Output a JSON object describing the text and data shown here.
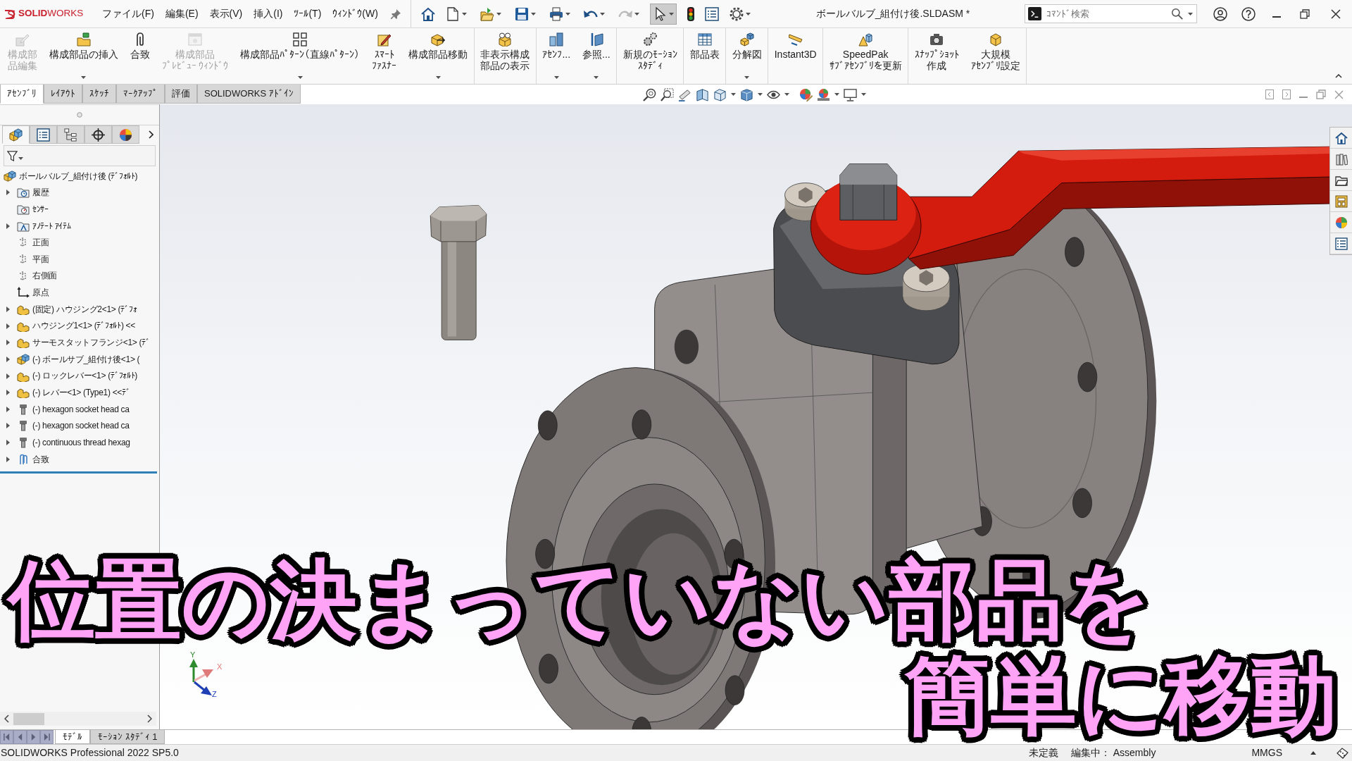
{
  "title_bar": {
    "logo": "**SOLID**WORKS",
    "menus": [
      "ファイル(F)",
      "編集(E)",
      "表示(V)",
      "挿入(I)",
      "ﾂｰﾙ(T)",
      "ｳｨﾝﾄﾞｳ(W)"
    ],
    "quick_access": [
      {
        "kind": "home",
        "dropdown": false,
        "disabled": false,
        "pressed": false
      },
      {
        "kind": "new",
        "dropdown": true,
        "disabled": false,
        "pressed": false
      },
      {
        "kind": "open",
        "dropdown": true,
        "disabled": false,
        "pressed": false
      },
      {
        "kind": "save",
        "dropdown": true,
        "disabled": false,
        "pressed": false
      },
      {
        "kind": "print",
        "dropdown": true,
        "disabled": false,
        "pressed": false
      },
      {
        "kind": "undo",
        "dropdown": true,
        "disabled": false,
        "pressed": false
      },
      {
        "kind": "redo",
        "dropdown": true,
        "disabled": true,
        "pressed": false
      },
      {
        "kind": "select",
        "dropdown": true,
        "disabled": false,
        "pressed": true
      },
      {
        "kind": "rebuild",
        "dropdown": false,
        "disabled": false,
        "pressed": false
      },
      {
        "kind": "properties",
        "dropdown": false,
        "disabled": false,
        "pressed": false
      },
      {
        "kind": "options",
        "dropdown": true,
        "disabled": false,
        "pressed": false
      }
    ],
    "document_title": "ボールバルブ_組付け後.SLDASM *",
    "search": {
      "placeholder": "ｺﾏﾝﾄﾞ検索"
    }
  },
  "command_manager": {
    "groups": [
      [
        {
          "kind": "edit",
          "lines": [
            "構成部",
            "品編集"
          ],
          "disabled": true,
          "dropdown": false
        },
        {
          "kind": "insert",
          "lines": [
            "構成部品の挿入"
          ],
          "disabled": false,
          "dropdown": true
        },
        {
          "kind": "mate",
          "lines": [
            "合致"
          ],
          "disabled": false,
          "dropdown": false
        },
        {
          "kind": "preview",
          "lines": [
            "構成部品",
            "ﾌﾟﾚﾋﾞｭｰ ｳｨﾝﾄﾞｳ"
          ],
          "disabled": true,
          "dropdown": false
        },
        {
          "kind": "pattern",
          "lines": [
            "構成部品ﾊﾟﾀｰﾝ（直線ﾊﾟﾀｰﾝ）"
          ],
          "disabled": false,
          "dropdown": true
        },
        {
          "kind": "fastener",
          "lines": [
            "ｽﾏｰﾄ",
            "ﾌｧｽﾅｰ"
          ],
          "disabled": false,
          "dropdown": false
        },
        {
          "kind": "move",
          "lines": [
            "構成部品移動"
          ],
          "disabled": false,
          "dropdown": true
        }
      ],
      [
        {
          "kind": "show",
          "lines": [
            "非表示構成",
            "部品の表示"
          ],
          "disabled": false,
          "dropdown": false
        }
      ],
      [
        {
          "kind": "assembly",
          "lines": [
            "ｱｾﾝﾌ..."
          ],
          "disabled": false,
          "dropdown": true
        },
        {
          "kind": "reference",
          "lines": [
            "参照..."
          ],
          "disabled": false,
          "dropdown": true
        }
      ],
      [
        {
          "kind": "motion",
          "lines": [
            "新規のﾓｰｼｮﾝ",
            "ｽﾀﾃﾞｨ"
          ],
          "disabled": false,
          "dropdown": false
        }
      ],
      [
        {
          "kind": "bom",
          "lines": [
            "部品表"
          ],
          "disabled": false,
          "dropdown": false
        }
      ],
      [
        {
          "kind": "explode",
          "lines": [
            "分解図"
          ],
          "disabled": false,
          "dropdown": true
        }
      ],
      [
        {
          "kind": "instant3d",
          "lines": [
            "Instant3D"
          ],
          "disabled": false,
          "dropdown": false
        }
      ],
      [
        {
          "kind": "speedpak",
          "lines": [
            "SpeedPak",
            "ｻﾌﾞｱｾﾝﾌﾞﾘを更新"
          ],
          "disabled": false,
          "dropdown": false
        }
      ],
      [
        {
          "kind": "snapshot",
          "lines": [
            "ｽﾅｯﾌﾟｼｮｯﾄ",
            "作成"
          ],
          "disabled": false,
          "dropdown": false
        },
        {
          "kind": "large",
          "lines": [
            "大規模",
            "ｱｾﾝﾌﾞﾘ設定"
          ],
          "disabled": false,
          "dropdown": false
        }
      ]
    ]
  },
  "command_tabs": [
    {
      "label": "ｱｾﾝﾌﾞﾘ",
      "selected": true
    },
    {
      "label": "ﾚｲｱｳﾄ",
      "selected": false
    },
    {
      "label": "ｽｹｯﾁ",
      "selected": false
    },
    {
      "label": "ﾏｰｸｱｯﾌﾟ",
      "selected": false
    },
    {
      "label": "評価",
      "selected": false
    },
    {
      "label": "SOLIDWORKS ｱﾄﾞｲﾝ",
      "selected": false
    }
  ],
  "feature_manager": {
    "tabs": [
      {
        "kind": "features",
        "selected": true
      },
      {
        "kind": "properties",
        "selected": false
      },
      {
        "kind": "configurations",
        "selected": false
      },
      {
        "kind": "dimxpert",
        "selected": false
      },
      {
        "kind": "display",
        "selected": false
      }
    ],
    "tree": {
      "label": "ボールバルブ_組付け後 (ﾃﾞﾌｫﾙﾄ)",
      "kind": "assembly",
      "children": [
        {
          "label": "履歴",
          "kind": "history",
          "expandable": true
        },
        {
          "label": "ｾﾝｻｰ",
          "kind": "sensor",
          "expandable": false
        },
        {
          "label": "ｱﾉﾃｰﾄ ｱｲﾃﾑ",
          "kind": "annotation",
          "expandable": true
        },
        {
          "label": "正面",
          "kind": "plane",
          "expandable": false
        },
        {
          "label": "平面",
          "kind": "plane",
          "expandable": false
        },
        {
          "label": "右側面",
          "kind": "plane",
          "expandable": false
        },
        {
          "label": "原点",
          "kind": "origin",
          "expandable": false
        },
        {
          "label": "(固定) ハウジング2<1> (ﾃﾞﾌｫ",
          "kind": "part",
          "expandable": true
        },
        {
          "label": "ハウジング1<1> (ﾃﾞﾌｫﾙﾄ) <<",
          "kind": "part",
          "expandable": true
        },
        {
          "label": "サーモスタットフランジ<1> (ﾃﾞ",
          "kind": "part",
          "expandable": true
        },
        {
          "label": "(-) ボールサブ_組付け後<1> (",
          "kind": "subassembly",
          "expandable": true
        },
        {
          "label": "(-) ロックレバー<1> (ﾃﾞﾌｫﾙﾄ)",
          "kind": "part",
          "expandable": true
        },
        {
          "label": "(-) レバー<1> (Type1) <<ﾃﾞ",
          "kind": "part",
          "expandable": true
        },
        {
          "label": "(-) hexagon socket head ca",
          "kind": "fastener",
          "expandable": true
        },
        {
          "label": "(-) hexagon socket head ca",
          "kind": "fastener",
          "expandable": true
        },
        {
          "label": "(-) continuous thread hexag",
          "kind": "fastener",
          "expandable": true
        },
        {
          "label": "合致",
          "kind": "mates",
          "expandable": true
        }
      ]
    }
  },
  "viewport": {
    "triad": [
      {
        "label": "Y",
        "color": "#2e8b2e"
      },
      {
        "label": "X",
        "color": "#e07a7a"
      },
      {
        "label": "Z",
        "color": "#1f3fb5"
      }
    ]
  },
  "caption": [
    "位置の決まっていない部品を",
    "簡単に移動"
  ],
  "bottom_tabs": [
    {
      "label": "ﾓﾃﾞﾙ",
      "selected": true
    },
    {
      "label": "ﾓｰｼｮﾝ ｽﾀﾃﾞｨ 1",
      "selected": false
    }
  ],
  "status_bar": {
    "product": "SOLIDWORKS Professional 2022 SP5.0",
    "definition": "未定義",
    "editing": "編集中： Assembly",
    "units": "MMGS"
  }
}
